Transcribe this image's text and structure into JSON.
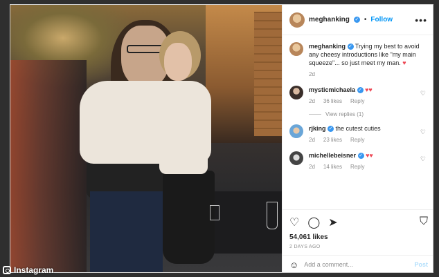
{
  "watermark": {
    "label": "Instagram"
  },
  "post": {
    "username": "meghanking",
    "follow_label": "Follow",
    "separator": "•",
    "more_label": "•••",
    "caption": {
      "username": "meghanking",
      "text": "Trying my best to avoid any cheesy introductions like \"my main squeeze\"... so just meet my man.",
      "emoji": "♥",
      "age": "2d"
    },
    "comments": [
      {
        "username": "mysticmichaela",
        "text": "",
        "emoji": "♥♥",
        "age": "2d",
        "likes": "36 likes",
        "reply": "Reply",
        "view_replies": "View replies (1)"
      },
      {
        "username": "rjking",
        "text": "the cutest cuties",
        "emoji": "",
        "age": "2d",
        "likes": "23 likes",
        "reply": "Reply",
        "view_replies": ""
      },
      {
        "username": "michellebeisner",
        "text": "",
        "emoji": "♥♥",
        "age": "2d",
        "likes": "14 likes",
        "reply": "Reply",
        "view_replies": ""
      }
    ],
    "likes_count": "54,061 likes",
    "date": "2 DAYS AGO",
    "add_comment_placeholder": "Add a comment...",
    "post_label": "Post"
  },
  "colors": {
    "link": "#0095f6",
    "verified": "#3897f0",
    "heart": "#ed4956"
  }
}
